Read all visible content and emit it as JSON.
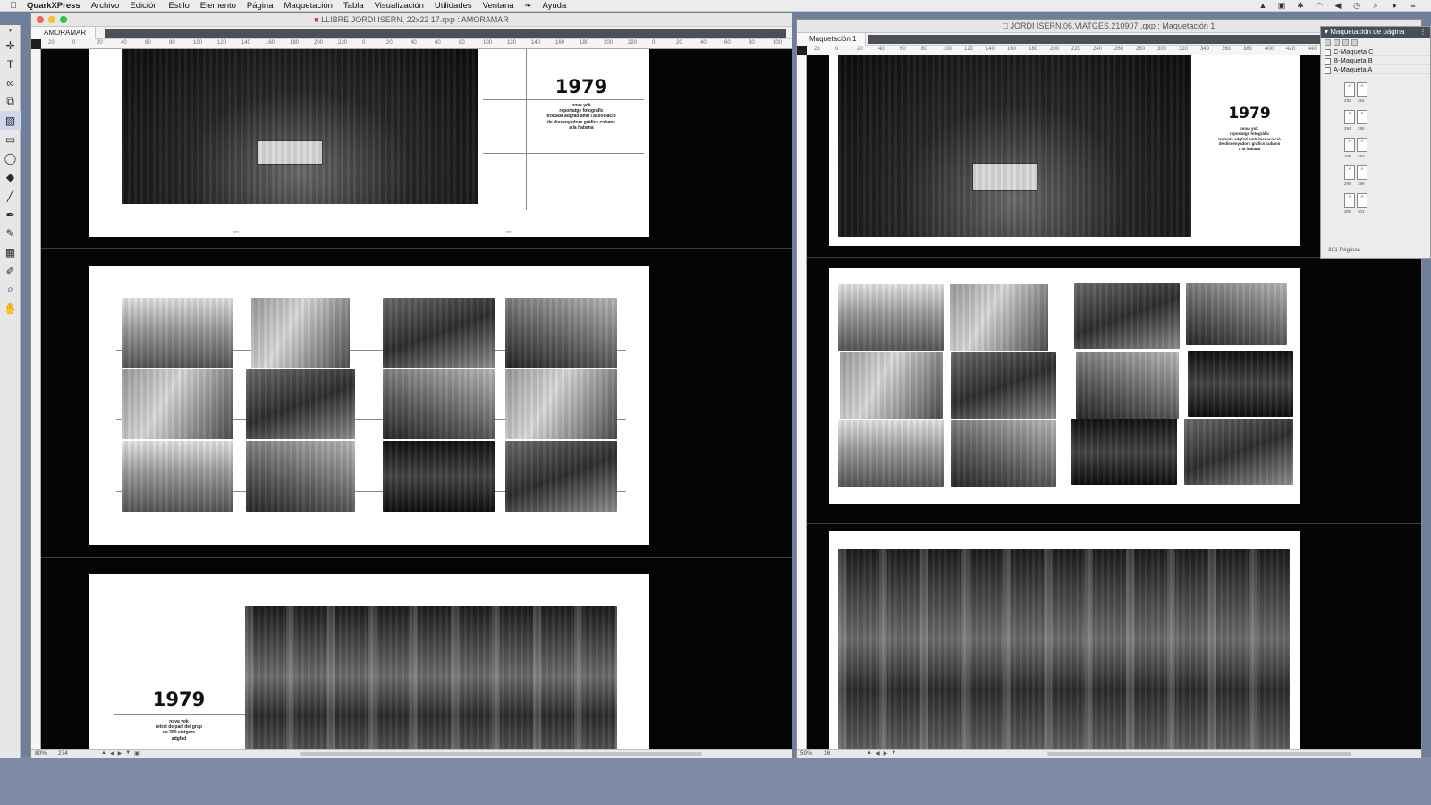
{
  "menubar": {
    "app_name": "QuarkXPress",
    "items": [
      "Archivo",
      "Edición",
      "Estilo",
      "Elemento",
      "Página",
      "Maquetación",
      "Tabla",
      "Visualización",
      "Utilidades",
      "Ventana",
      "Ayuda"
    ]
  },
  "window_left": {
    "title": "LLIBRE JORDI ISERN. 22x22 17.qxp : AMORAMAR",
    "tab": "AMORAMAR",
    "zoom": "80%",
    "page_number": "274",
    "ruler_ticks": [
      "20",
      "0",
      "20",
      "40",
      "60",
      "80",
      "100",
      "120",
      "140",
      "160",
      "180",
      "200",
      "220",
      "0",
      "20",
      "40",
      "60",
      "80",
      "100",
      "120",
      "140",
      "160",
      "180",
      "200",
      "220",
      "0",
      "20",
      "40",
      "60",
      "80",
      "100"
    ]
  },
  "window_right": {
    "title": "JORDI ISERN.06.VIATGES.210907 .qxp : Maquetación 1",
    "tab": "Maquetación 1",
    "zoom": "50%",
    "page_number": "16",
    "ruler_ticks": [
      "20",
      "0",
      "20",
      "40",
      "60",
      "80",
      "100",
      "120",
      "140",
      "160",
      "180",
      "200",
      "220",
      "240",
      "260",
      "280",
      "300",
      "320",
      "340",
      "360",
      "380",
      "400",
      "420",
      "440",
      "460",
      "480",
      "500",
      "520",
      "540"
    ]
  },
  "spread_1": {
    "year": "1979",
    "caption_lines": [
      "nova yok",
      "reportatge fotogràfic",
      "trobada adgfad amb l'associació",
      "de dissenyadors gràfics cubans",
      "a la habana"
    ],
    "folio_left": "001",
    "folio_right": "001"
  },
  "spread_3": {
    "year": "1979",
    "caption_lines": [
      "nova yok",
      "retrat de part del grup",
      "de 300 viatgers",
      "adgfad"
    ]
  },
  "palette": {
    "title": "Maquetación de página",
    "masters": [
      "C-Maqueta C",
      "B-Maqueta B",
      "A-Maqueta A"
    ],
    "page_pairs": [
      [
        "292",
        "293"
      ],
      [
        "294",
        "295"
      ],
      [
        "296",
        "297"
      ],
      [
        "298",
        "299"
      ],
      [
        "300",
        "301"
      ]
    ],
    "footer": "301 Páginas"
  }
}
